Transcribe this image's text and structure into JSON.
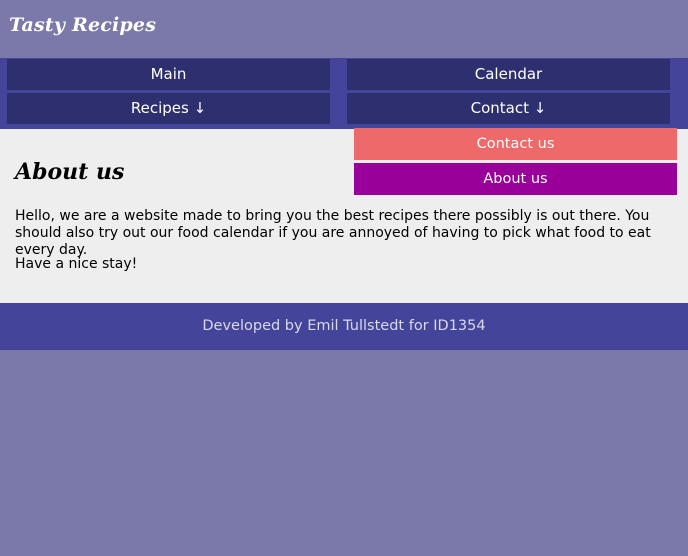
{
  "site": {
    "logo_text": "Tasty Recipes"
  },
  "nav": {
    "main": "Main",
    "calendar": "Calendar",
    "recipes": "Recipes ↓",
    "contact": "Contact ↓"
  },
  "dropdown": {
    "contact_us": "Contact us",
    "about_us": "About us"
  },
  "content": {
    "title": "About us",
    "paragraph1": "Hello, we are a website made to bring you the best recipes there possibly is out there. You should also try out our food calendar if you are annoyed of having to pick what food to eat every day.",
    "paragraph2": "Have a nice stay!"
  },
  "footer": {
    "text": "Developed by Emil Tullstedt for ID1354"
  },
  "colors": {
    "background": "#7a79aa",
    "nav_bar": "#44449a",
    "nav_button": "#2d2f6e",
    "content_bg": "#efeeee",
    "dropdown_contact": "#ee6a6a",
    "dropdown_about": "#990099",
    "footer_text": "#d8d8ea"
  }
}
